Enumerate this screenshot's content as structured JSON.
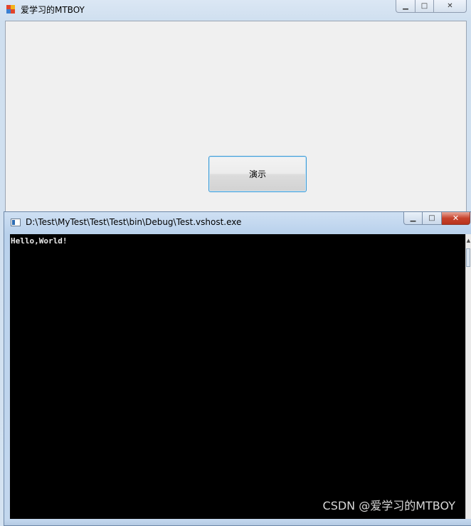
{
  "form": {
    "title": "爱学习的MTBOY",
    "demo_button_label": "演示"
  },
  "console": {
    "title": "D:\\Test\\MyTest\\Test\\Test\\bin\\Debug\\Test.vshost.exe",
    "output": "Hello,World!"
  },
  "watermark": "CSDN @爱学习的MTBOY",
  "icons": {
    "form_app": "winforms-app-icon",
    "console_app": "console-app-icon",
    "minimize": "minimize-icon",
    "maximize": "maximize-icon",
    "close": "close-icon"
  }
}
